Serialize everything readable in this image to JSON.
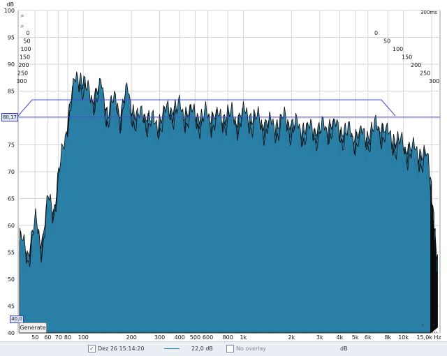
{
  "chart_data": {
    "type": "area",
    "title": "",
    "ylabel": "dB",
    "xlabel": "Hz",
    "ylim": [
      40,
      100
    ],
    "x_scale": "log",
    "xlim": [
      40,
      15000
    ],
    "y_ticks": [
      "100",
      "95",
      "90",
      "85",
      "80",
      "75",
      "70",
      "65",
      "60",
      "55",
      "50",
      "45",
      "40"
    ],
    "x_ticks": [
      {
        "v": 50,
        "label": "50"
      },
      {
        "v": 60,
        "label": "60"
      },
      {
        "v": 70,
        "label": "70"
      },
      {
        "v": 80,
        "label": "80"
      },
      {
        "v": 100,
        "label": "100"
      },
      {
        "v": 200,
        "label": "200"
      },
      {
        "v": 300,
        "label": "300"
      },
      {
        "v": 400,
        "label": "400"
      },
      {
        "v": 500,
        "label": "500"
      },
      {
        "v": 600,
        "label": "600"
      },
      {
        "v": 800,
        "label": "800"
      },
      {
        "v": 1000,
        "label": "1k"
      },
      {
        "v": 2000,
        "label": "2k"
      },
      {
        "v": 3000,
        "label": "3k"
      },
      {
        "v": 4000,
        "label": "4k"
      },
      {
        "v": 5000,
        "label": "5k"
      },
      {
        "v": 6000,
        "label": "6k"
      },
      {
        "v": 8000,
        "label": "8k"
      },
      {
        "v": 10000,
        "label": "10k"
      },
      {
        "v": 15000,
        "label": "15,0k Hz"
      }
    ],
    "time_ticks_left": [
      "0",
      "50",
      "100",
      "150",
      "200",
      "250",
      "300"
    ],
    "time_ticks_right": [
      "0",
      "50",
      "100",
      "150",
      "200",
      "250",
      "300"
    ],
    "time_max_label": "300ms",
    "y_min_label": "40,0",
    "threshold_db": 80.17,
    "threshold_label": "80,17",
    "series_color": "#2a7fa6",
    "outline_color": "#0b0b0b",
    "slice_count": 22,
    "envelope": {
      "freq": [
        40,
        45,
        50,
        55,
        60,
        65,
        70,
        75,
        80,
        85,
        90,
        95,
        100,
        110,
        120,
        130,
        140,
        150,
        160,
        170,
        180,
        190,
        200,
        220,
        240,
        260,
        280,
        300,
        350,
        400,
        450,
        500,
        550,
        600,
        700,
        800,
        900,
        1000,
        1200,
        1400,
        1600,
        1800,
        2000,
        2500,
        3000,
        3500,
        4000,
        5000,
        6000,
        7000,
        8000,
        9000,
        10000,
        12000,
        14000,
        15000
      ],
      "db": [
        63,
        60,
        66,
        62,
        70,
        68,
        75,
        79,
        86,
        90,
        92,
        93,
        92,
        89,
        90,
        91,
        86,
        88,
        88,
        86,
        89,
        90,
        87,
        85,
        86,
        85,
        84,
        85,
        87,
        87,
        86,
        86,
        85,
        86,
        85,
        86,
        85,
        86,
        85,
        84,
        84,
        85,
        84,
        83,
        83,
        84,
        83,
        82,
        82,
        84,
        82,
        81,
        80,
        79,
        78,
        72
      ]
    }
  },
  "status_bar": {
    "measurement_label": "Dez 26 15:14:20",
    "checkbox_checked": "✓",
    "smoothing_value": "22,0 dB",
    "overlay_label": "No overlay",
    "unit_label": "dB"
  },
  "buttons": {
    "generate": "Generate"
  }
}
